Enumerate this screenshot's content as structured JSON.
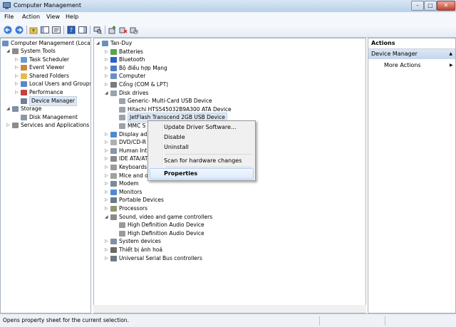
{
  "window": {
    "title": "Computer Management",
    "controls": {
      "minimize": "–",
      "maximize": "□",
      "close": "✕"
    }
  },
  "menu": {
    "items": [
      "File",
      "Action",
      "View",
      "Help"
    ]
  },
  "toolbar": {
    "icons": [
      "back-icon",
      "forward-icon",
      "up-folder-icon",
      "show-hide-tree-icon",
      "properties-icon",
      "help-icon",
      "show-action-pane-icon",
      "scan-hardware-icon",
      "update-driver-icon",
      "uninstall-icon",
      "disable-icon"
    ]
  },
  "left_tree": {
    "root": "Computer Management (Local",
    "items": [
      {
        "label": "System Tools",
        "level": 1,
        "arrow": "◢",
        "icon": "tools-icon"
      },
      {
        "label": "Task Scheduler",
        "level": 2,
        "arrow": "▷",
        "icon": "clock-icon"
      },
      {
        "label": "Event Viewer",
        "level": 2,
        "arrow": "▷",
        "icon": "event-viewer-icon"
      },
      {
        "label": "Shared Folders",
        "level": 2,
        "arrow": "▷",
        "icon": "folder-icon"
      },
      {
        "label": "Local Users and Groups",
        "level": 2,
        "arrow": "▷",
        "icon": "users-icon"
      },
      {
        "label": "Performance",
        "level": 2,
        "arrow": "▷",
        "icon": "performance-icon"
      },
      {
        "label": "Device Manager",
        "level": 2,
        "arrow": "",
        "icon": "device-manager-icon",
        "selected": true
      },
      {
        "label": "Storage",
        "level": 1,
        "arrow": "◢",
        "icon": "storage-icon"
      },
      {
        "label": "Disk Management",
        "level": 2,
        "arrow": "",
        "icon": "disk-icon"
      },
      {
        "label": "Services and Applications",
        "level": 1,
        "arrow": "▷",
        "icon": "services-icon"
      }
    ]
  },
  "device_tree": {
    "root": "Tan-Duy",
    "items": [
      {
        "label": "Batteries",
        "level": 1,
        "arrow": "▷",
        "icon": "battery-icon"
      },
      {
        "label": "Bluetooth",
        "level": 1,
        "arrow": "▷",
        "icon": "bluetooth-icon"
      },
      {
        "label": "Bộ điều hợp Mạng",
        "level": 1,
        "arrow": "▷",
        "icon": "network-adapter-icon"
      },
      {
        "label": "Computer",
        "level": 1,
        "arrow": "▷",
        "icon": "computer-icon"
      },
      {
        "label": "Cổng (COM & LPT)",
        "level": 1,
        "arrow": "▷",
        "icon": "port-icon"
      },
      {
        "label": "Disk drives",
        "level": 1,
        "arrow": "◢",
        "icon": "disk-drive-icon"
      },
      {
        "label": "Generic- Multi-Card USB Device",
        "level": 2,
        "arrow": "",
        "icon": "disk-drive-icon"
      },
      {
        "label": "Hitachi HTS545032B9A300 ATA Device",
        "level": 2,
        "arrow": "",
        "icon": "disk-drive-icon"
      },
      {
        "label": "JetFlash Transcend 2GB USB Device",
        "level": 2,
        "arrow": "",
        "icon": "disk-drive-icon",
        "selected": true
      },
      {
        "label": "MMC S",
        "level": 2,
        "arrow": "",
        "icon": "disk-drive-icon"
      },
      {
        "label": "Display ad",
        "level": 1,
        "arrow": "▷",
        "icon": "display-icon"
      },
      {
        "label": "DVD/CD-R",
        "level": 1,
        "arrow": "▷",
        "icon": "dvd-icon"
      },
      {
        "label": "Human Int",
        "level": 1,
        "arrow": "▷",
        "icon": "hid-icon"
      },
      {
        "label": "IDE ATA/AT",
        "level": 1,
        "arrow": "▷",
        "icon": "ide-icon"
      },
      {
        "label": "Keyboards",
        "level": 1,
        "arrow": "▷",
        "icon": "keyboard-icon"
      },
      {
        "label": "Mice and o",
        "level": 1,
        "arrow": "▷",
        "icon": "mouse-icon"
      },
      {
        "label": "Modem",
        "level": 1,
        "arrow": "▷",
        "icon": "modem-icon"
      },
      {
        "label": "Monitors",
        "level": 1,
        "arrow": "▷",
        "icon": "monitor-icon"
      },
      {
        "label": "Portable Devices",
        "level": 1,
        "arrow": "▷",
        "icon": "portable-device-icon"
      },
      {
        "label": "Processors",
        "level": 1,
        "arrow": "▷",
        "icon": "processor-icon"
      },
      {
        "label": "Sound, video and game controllers",
        "level": 1,
        "arrow": "◢",
        "icon": "sound-icon"
      },
      {
        "label": "High Definition Audio Device",
        "level": 2,
        "arrow": "",
        "icon": "speaker-icon"
      },
      {
        "label": "High Definition Audio Device",
        "level": 2,
        "arrow": "",
        "icon": "speaker-icon"
      },
      {
        "label": "System devices",
        "level": 1,
        "arrow": "▷",
        "icon": "system-device-icon"
      },
      {
        "label": "Thiết bị ảnh hoá",
        "level": 1,
        "arrow": "▷",
        "icon": "imaging-device-icon"
      },
      {
        "label": "Universal Serial Bus controllers",
        "level": 1,
        "arrow": "▷",
        "icon": "usb-icon"
      }
    ]
  },
  "context_menu": {
    "update": "Update Driver Software...",
    "disable": "Disable",
    "uninstall": "Uninstall",
    "scan": "Scan for hardware changes",
    "properties": "Properties"
  },
  "actions": {
    "title": "Actions",
    "section": "Device Manager",
    "more": "More Actions"
  },
  "status": {
    "text": "Opens property sheet for the current selection."
  },
  "colors": {
    "selection": "#dde7f3",
    "title_bar": "#c4d8ee",
    "context_hover": "#dbeafd"
  }
}
